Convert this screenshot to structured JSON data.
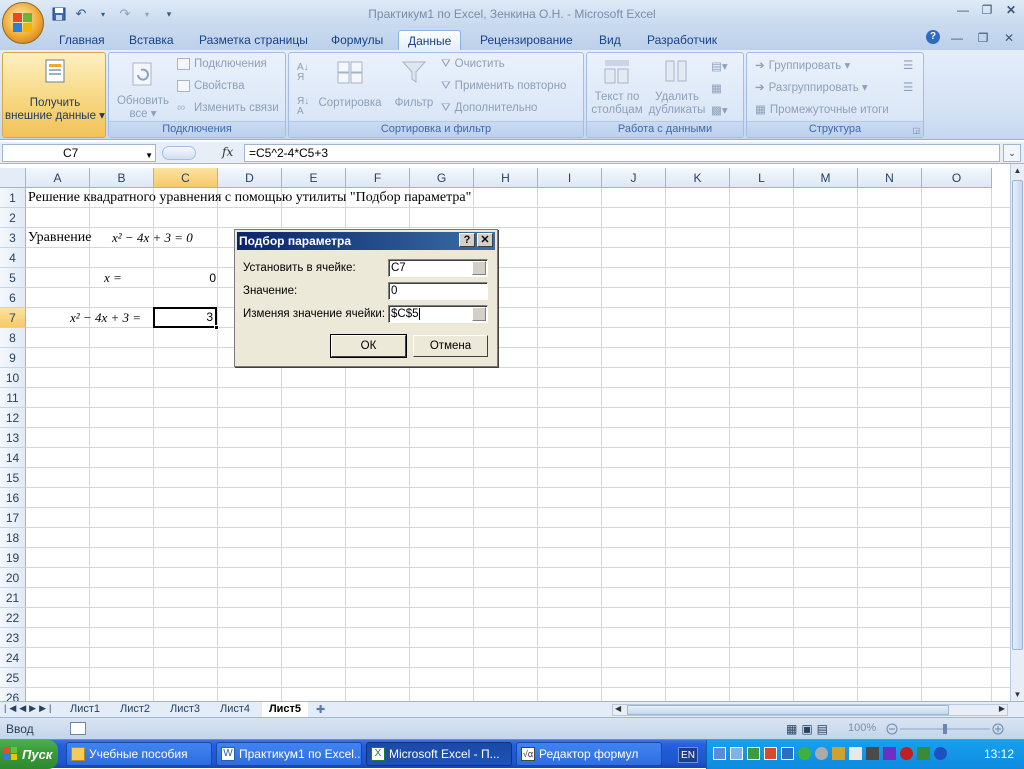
{
  "window": {
    "title": "Практикум1 по Excel, Зенкина О.Н. - Microsoft Excel"
  },
  "ribbon": {
    "tabs": [
      {
        "label": "Главная"
      },
      {
        "label": "Вставка"
      },
      {
        "label": "Разметка страницы"
      },
      {
        "label": "Формулы"
      },
      {
        "label": "Данные",
        "active": true
      },
      {
        "label": "Рецензирование"
      },
      {
        "label": "Вид"
      },
      {
        "label": "Разработчик"
      }
    ],
    "groups": {
      "external": {
        "btn_line1": "Получить",
        "btn_line2": "внешние данные"
      },
      "connections": {
        "label": "Подключения",
        "refresh_line1": "Обновить",
        "refresh_line2": "все",
        "connections": "Подключения",
        "properties": "Свойства",
        "edit_links": "Изменить связи"
      },
      "sort": {
        "label": "Сортировка и фильтр",
        "sort": "Сортировка",
        "filter": "Фильтр",
        "clear": "Очистить",
        "reapply": "Применить повторно",
        "advanced": "Дополнительно"
      },
      "data_tools": {
        "label": "Работа с данными",
        "text_cols_line1": "Текст по",
        "text_cols_line2": "столбцам",
        "remove_dup_line1": "Удалить",
        "remove_dup_line2": "дубликаты"
      },
      "outline": {
        "label": "Структура",
        "group": "Группировать",
        "ungroup": "Разгруппировать",
        "subtotal": "Промежуточные итоги"
      }
    }
  },
  "formula_bar": {
    "name_box": "C7",
    "fx": "fx",
    "formula": "=C5^2-4*C5+3"
  },
  "sheet": {
    "columns": [
      "A",
      "B",
      "C",
      "D",
      "E",
      "F",
      "G",
      "H",
      "I",
      "J",
      "K",
      "L",
      "M",
      "N",
      "O"
    ],
    "selected_column": "C",
    "rows": [
      "1",
      "2",
      "3",
      "4",
      "5",
      "6",
      "7",
      "8",
      "9",
      "10",
      "11",
      "12",
      "13",
      "14",
      "15",
      "16",
      "17",
      "18",
      "19",
      "20",
      "21",
      "22",
      "23",
      "24",
      "25",
      "26"
    ],
    "selected_row": "7",
    "cells": {
      "A1": "Решение квадратного уравнения с помощью утилиты \"Подбор параметра\"",
      "A3": "Уравнение",
      "eq_header": "x² − 4x + 3 = 0",
      "x_label": "x  =",
      "C5": "0",
      "eq_row7": "x² − 4x + 3 =",
      "C7": "3"
    }
  },
  "dialog": {
    "title": "Подбор параметра",
    "set_cell_label": "Установить в ячейке:",
    "set_cell_value": "C7",
    "value_label": "Значение:",
    "value_value": "0",
    "changing_label": "Изменяя значение ячейки:",
    "changing_value": "$C$5",
    "ok": "ОК",
    "cancel": "Отмена"
  },
  "sheet_tabs": [
    {
      "label": "Лист1"
    },
    {
      "label": "Лист2"
    },
    {
      "label": "Лист3"
    },
    {
      "label": "Лист4"
    },
    {
      "label": "Лист5",
      "active": true
    }
  ],
  "status": {
    "mode": "Ввод",
    "zoom": "100%"
  },
  "taskbar": {
    "start": "Пуск",
    "tasks": [
      {
        "label": "Учебные пособия"
      },
      {
        "label": "Практикум1 по Excel..."
      },
      {
        "label": "Microsoft Excel - П...",
        "active": true
      },
      {
        "label": "Редактор формул"
      }
    ],
    "lang": "EN",
    "clock": "13:12"
  }
}
